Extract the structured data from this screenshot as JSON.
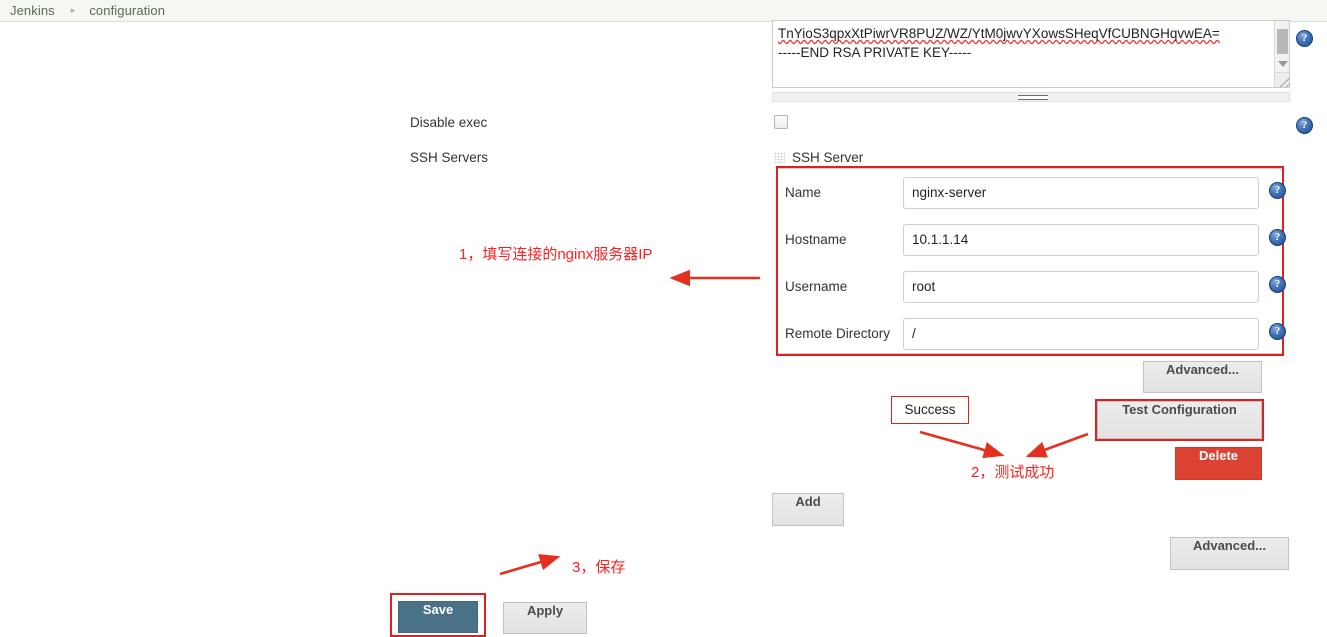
{
  "breadcrumb": {
    "root": "Jenkins",
    "separator": "▸",
    "current": "configuration"
  },
  "private_key": {
    "line1": "TnYioS3qpxXtPiwrVR8PUZ/WZ/YtM0jwvYXowsSHeqVfCUBNGHqvwEA=",
    "line2": "-----END RSA PRIVATE KEY-----"
  },
  "fields": {
    "disable_exec_label": "Disable exec",
    "ssh_servers_label": "SSH Servers"
  },
  "ssh_server": {
    "title": "SSH Server",
    "rows": [
      {
        "label": "Name",
        "value": "nginx-server"
      },
      {
        "label": "Hostname",
        "value": "10.1.1.14"
      },
      {
        "label": "Username",
        "value": "root"
      },
      {
        "label": "Remote Directory",
        "value": "/"
      }
    ]
  },
  "buttons": {
    "advanced_server": "Advanced...",
    "test_configuration": "Test Configuration",
    "delete": "Delete",
    "add": "Add",
    "advanced_section": "Advanced...",
    "save": "Save",
    "apply": "Apply"
  },
  "status": {
    "test_result": "Success"
  },
  "annotations": {
    "note1": "1，填写连接的nginx服务器IP",
    "note2": "2，测试成功",
    "note3": "3，保存"
  },
  "icons": {
    "help": "?"
  },
  "colors": {
    "annotation_red": "#ff2020",
    "delete_red": "#dc4232",
    "save_teal": "#4a7287",
    "breadcrumb_bg": "#f4f7f2"
  }
}
